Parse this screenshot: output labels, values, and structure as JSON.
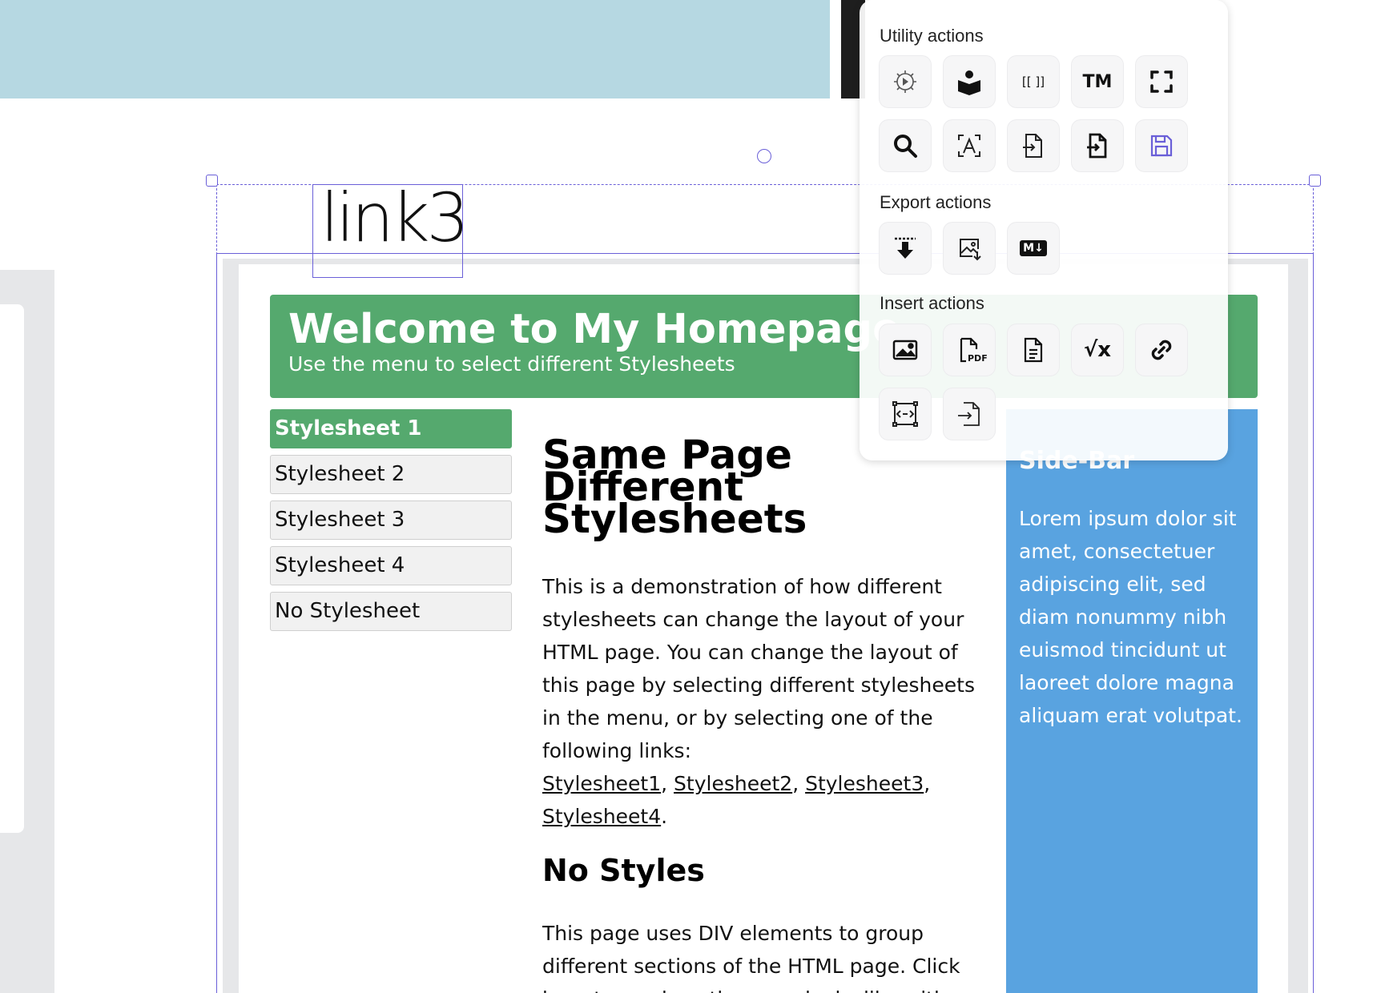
{
  "canvas": {
    "handwritten_text": "link3"
  },
  "webpage": {
    "header": {
      "title": "Welcome to My Homepage",
      "subtitle": "Use the menu to select different Stylesheets"
    },
    "menu": [
      {
        "label": "Stylesheet 1",
        "active": true
      },
      {
        "label": "Stylesheet 2",
        "active": false
      },
      {
        "label": "Stylesheet 3",
        "active": false
      },
      {
        "label": "Stylesheet 4",
        "active": false
      },
      {
        "label": "No Stylesheet",
        "active": false
      }
    ],
    "main": {
      "heading_line1": "Same Page",
      "heading_line2": "Different",
      "heading_line3": "Stylesheets",
      "paragraph1": "This is a demonstration of how different stylesheets can change the layout of your HTML page. You can change the layout of this page by selecting different stylesheets in the menu, or by selecting one of the following links:",
      "links": [
        "Stylesheet1",
        "Stylesheet2",
        "Stylesheet3",
        "Stylesheet4"
      ],
      "link_sep": ", ",
      "link_end": ".",
      "heading2": "No Styles",
      "paragraph2": "This page uses DIV elements to group different sections of the HTML page. Click here to see how the page looks like with no"
    },
    "sidebar": {
      "title": "Side-Bar",
      "text": "Lorem ipsum dolor sit amet, consectetuer adipiscing elit, sed diam nonummy nibh euismod tincidunt ut laoreet dolore magna aliquam erat volutpat."
    }
  },
  "popover": {
    "utility_label": "Utility actions",
    "export_label": "Export actions",
    "insert_label": "Insert actions",
    "utility_actions": [
      {
        "icon": "settings-play-icon"
      },
      {
        "icon": "reader-icon"
      },
      {
        "icon": "wiki-link-icon",
        "text": "[[ ]]"
      },
      {
        "icon": "trademark-icon",
        "text": "TM"
      },
      {
        "icon": "fullscreen-icon"
      },
      {
        "icon": "search-icon"
      },
      {
        "icon": "ocr-icon"
      },
      {
        "icon": "import-file-icon"
      },
      {
        "icon": "import-file-bold-icon"
      },
      {
        "icon": "save-icon",
        "color": "#6a5fd8"
      }
    ],
    "export_actions": [
      {
        "icon": "export-download-icon"
      },
      {
        "icon": "export-image-icon"
      },
      {
        "icon": "markdown-icon",
        "text": "M↓"
      }
    ],
    "insert_actions": [
      {
        "icon": "insert-image-icon"
      },
      {
        "icon": "insert-pdf-icon",
        "text": "PDF"
      },
      {
        "icon": "insert-file-icon"
      },
      {
        "icon": "insert-latex-icon",
        "text": "√x"
      },
      {
        "icon": "insert-link-icon"
      },
      {
        "icon": "embed-icon"
      },
      {
        "icon": "insert-import-icon"
      }
    ]
  },
  "colors": {
    "selection": "#6a5fd8",
    "header_green": "#55a96e",
    "sidebar_blue": "#59a3e0",
    "canvas_blue": "#b6d8e2"
  }
}
